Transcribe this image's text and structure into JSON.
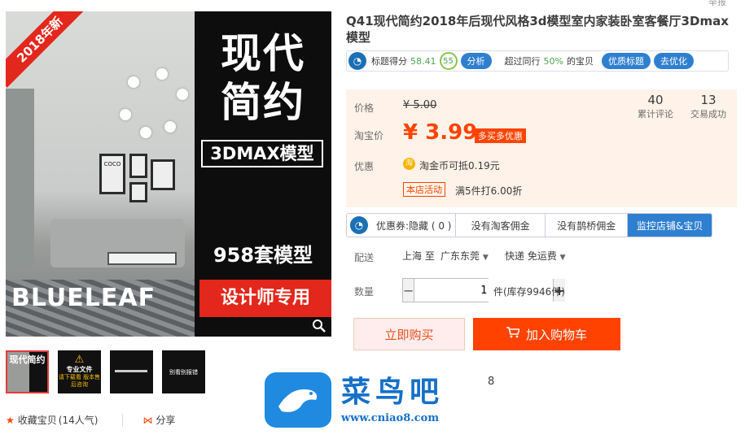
{
  "top_link": "举报",
  "gallery": {
    "ribbon": "2018年新",
    "brand": "BLUELEAF",
    "title_line1": "现代",
    "title_line2": "简约",
    "format_box": "3DMAX模型",
    "models": "958套模型",
    "designer": "设计师专用",
    "frame_text": "COCO"
  },
  "thumbnails": [
    {
      "title": "现代简约"
    },
    {
      "title": "专业文件",
      "sub": "请下载看\n版本售后咨询"
    },
    {
      "title": ""
    },
    {
      "title": "别看别报错"
    }
  ],
  "bottom": {
    "collect": "收藏宝贝",
    "collect_count": "(14人气)",
    "share": "分享"
  },
  "product": {
    "title": "Q41现代简约2018年后现代风格3d模型室内家装卧室客餐厅3Dmax模型"
  },
  "score_bar": {
    "label": "标题得分",
    "score": "58.41",
    "badge": "55",
    "analyze": "分析",
    "beyond": "超过同行",
    "pct": "50%",
    "of": "的宝贝",
    "optimize_title": "优质标题",
    "go_optimize": "去优化"
  },
  "price": {
    "price_label": "价格",
    "original": "¥ 5.00",
    "taobao_label": "淘宝价",
    "current": "¥ 3.99",
    "discount_tag": "多买多优惠",
    "reviews_count": "40",
    "reviews_label": "累计评论",
    "sales_count": "13",
    "sales_label": "交易成功",
    "promo_label": "优惠",
    "coin_icon_text": "淘",
    "coin_text": "淘金币可抵0.19元",
    "store_tag": "本店活动",
    "store_offer": "满5件打6.00折"
  },
  "tabs": [
    {
      "label": "优惠券:隐藏 ( 0 )"
    },
    {
      "label": "没有淘客佣金"
    },
    {
      "label": "没有鹊桥佣金"
    },
    {
      "label": "监控店铺&宝贝"
    }
  ],
  "delivery": {
    "label": "配送",
    "from": "上海 至",
    "to": "广东东莞",
    "method": "快递 免运费"
  },
  "quantity": {
    "label": "数量",
    "value": "1",
    "minus": "−",
    "plus": "+",
    "stock": "件(库存9946件)"
  },
  "buttons": {
    "buy_now": "立即购买",
    "add_cart": "加入购物车"
  },
  "watermark": {
    "text": "菜鸟吧",
    "url": "www.cniao8.com"
  },
  "stray": "8"
}
